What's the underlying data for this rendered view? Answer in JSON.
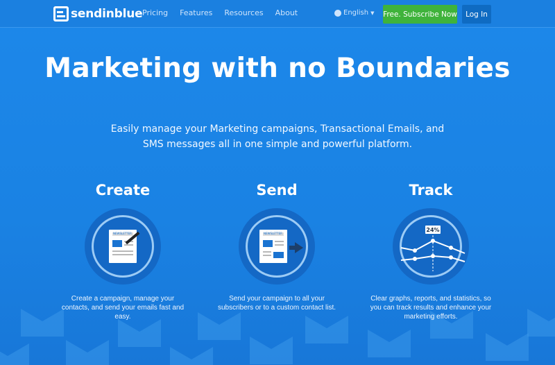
{
  "nav": {
    "logo_text": "sendinblue",
    "links": [
      "Pricing",
      "Features",
      "Resources",
      "About"
    ],
    "language": "English",
    "subscribe_label": "Free. Subscribe Now",
    "login_label": "Log In"
  },
  "hero": {
    "title": "Marketing with no Boundaries",
    "subtitle_line1": "Easily manage your Marketing campaigns, Transactional Emails, and",
    "subtitle_line2": "SMS messages all in one simple and powerful platform."
  },
  "features": [
    {
      "title": "Create",
      "icon_text": "NEWSLETTER",
      "desc_line1": "Create a campaign, manage your",
      "desc_line2": "contacts, and send your emails fast and",
      "desc_line3": "easy."
    },
    {
      "title": "Send",
      "icon_text": "NEWSLETTER",
      "desc_line1": "Send your campaign to all your",
      "desc_line2": "subscribers or to a custom contact list.",
      "desc_line3": ""
    },
    {
      "title": "Track",
      "icon_text": "24%",
      "desc_line1": "Clear graphs, reports, and statistics, so",
      "desc_line2": "you can track results and enhance your",
      "desc_line3": "marketing efforts."
    }
  ],
  "colors": {
    "background": "#1a84e6",
    "subscribe_button": "#3fb33b",
    "login_button": "#0f6bc2"
  }
}
